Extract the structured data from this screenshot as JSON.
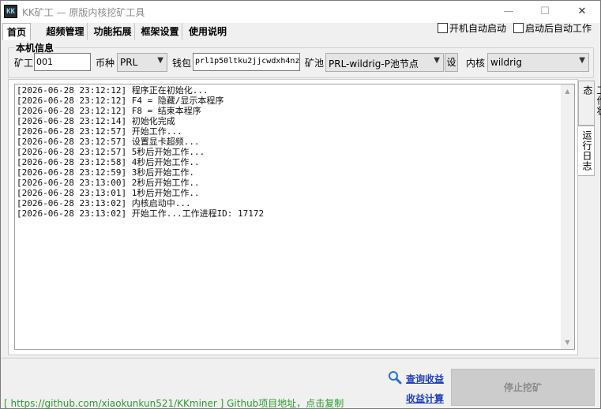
{
  "window": {
    "app_icon_text": "KK",
    "title": "KK矿工 — 原版内核挖矿工具",
    "min": "—",
    "max": "☐",
    "close": "✕"
  },
  "tabs": [
    {
      "label": "首页",
      "active": true
    },
    {
      "label": "超频管理",
      "active": false
    },
    {
      "label": "功能拓展",
      "active": false
    },
    {
      "label": "框架设置",
      "active": false
    },
    {
      "label": "使用说明",
      "active": false
    }
  ],
  "options": {
    "autostart_label": "开机自动启动",
    "autowork_label": "启动后自动工作",
    "autostart_checked": false,
    "autowork_checked": false
  },
  "info": {
    "group_title": "本机信息",
    "worker_label": "矿工",
    "worker_value": "001",
    "coin_label": "币种",
    "coin_value": "PRL",
    "wallet_label": "钱包",
    "wallet_value": "prl1p50ltku2jjcwdxh4nz",
    "pool_label": "矿池",
    "pool_value": "PRL-wildrig-P池节点",
    "pool_setting_btn": "设",
    "kernel_label": "内核",
    "kernel_value": "wildrig"
  },
  "log": {
    "lines": [
      "[2026-06-28 23:12:12] 程序正在初始化...",
      "[2026-06-28 23:12:12] F4 = 隐藏/显示本程序",
      "[2026-06-28 23:12:12] F8 = 结束本程序",
      "[2026-06-28 23:12:14] 初始化完成",
      "[2026-06-28 23:12:57] 开始工作...",
      "[2026-06-28 23:12:57] 设置显卡超频...",
      "[2026-06-28 23:12:57] 5秒后开始工作...",
      "[2026-06-28 23:12:58] 4秒后开始工作..",
      "[2026-06-28 23:12:59] 3秒后开始工作.",
      "[2026-06-28 23:13:00] 2秒后开始工作..",
      "[2026-06-28 23:13:01] 1秒后开始工作..",
      "[2026-06-28 23:13:02] 内核启动中...",
      "[2026-06-28 23:13:02] 开始工作...工作进程ID: 17172"
    ]
  },
  "side_tabs": [
    {
      "label": "工作状态",
      "active": false
    },
    {
      "label": "运行日志",
      "active": true
    }
  ],
  "footer": {
    "github_text": "[ https://github.com/xiaokunkun521/KKminer ] Github项目地址，点击复制",
    "query_label": "查询收益",
    "calc_label": "收益计算",
    "stop_label": "停止挖矿"
  }
}
